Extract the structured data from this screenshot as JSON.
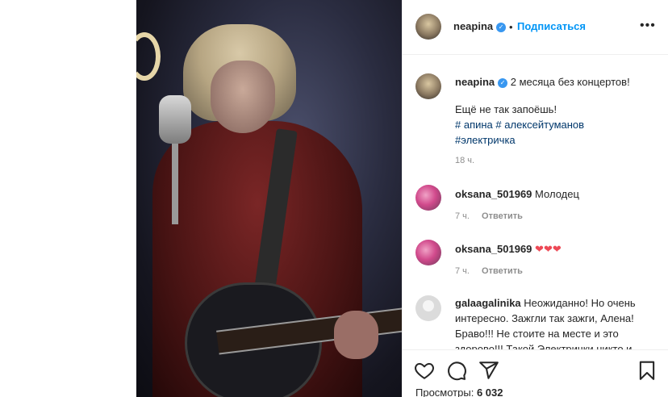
{
  "post": {
    "username": "neapina",
    "follow_label": "Подписаться",
    "dot": "•",
    "more_label": "•••"
  },
  "caption": {
    "username": "neapina",
    "text": "2 месяца без концертов!",
    "line2": "Ещё не так запоёшь!",
    "hashtag1": "# апина",
    "hashtag2": "# алексейтуманов",
    "hashtag3": "#электричка",
    "time": "18 ч."
  },
  "comments": [
    {
      "username": "oksana_501969",
      "text": "Молодец",
      "time": "7 ч.",
      "reply": "Ответить"
    },
    {
      "username": "oksana_501969",
      "text": "❤❤❤",
      "time": "7 ч.",
      "reply": "Ответить"
    },
    {
      "username": "galaagalinika",
      "text": "Неожиданно! Но очень интересно. Зажгли так зажги, Алена! Браво!!! Не стоите на месте и это здорово!!! Такой Электрички никто и"
    }
  ],
  "footer": {
    "views_label": "Просмотры:",
    "views_count": "6 032"
  },
  "icons": {
    "like": "heart-outline",
    "comment": "speech-bubble",
    "share": "paper-plane",
    "save": "bookmark"
  }
}
